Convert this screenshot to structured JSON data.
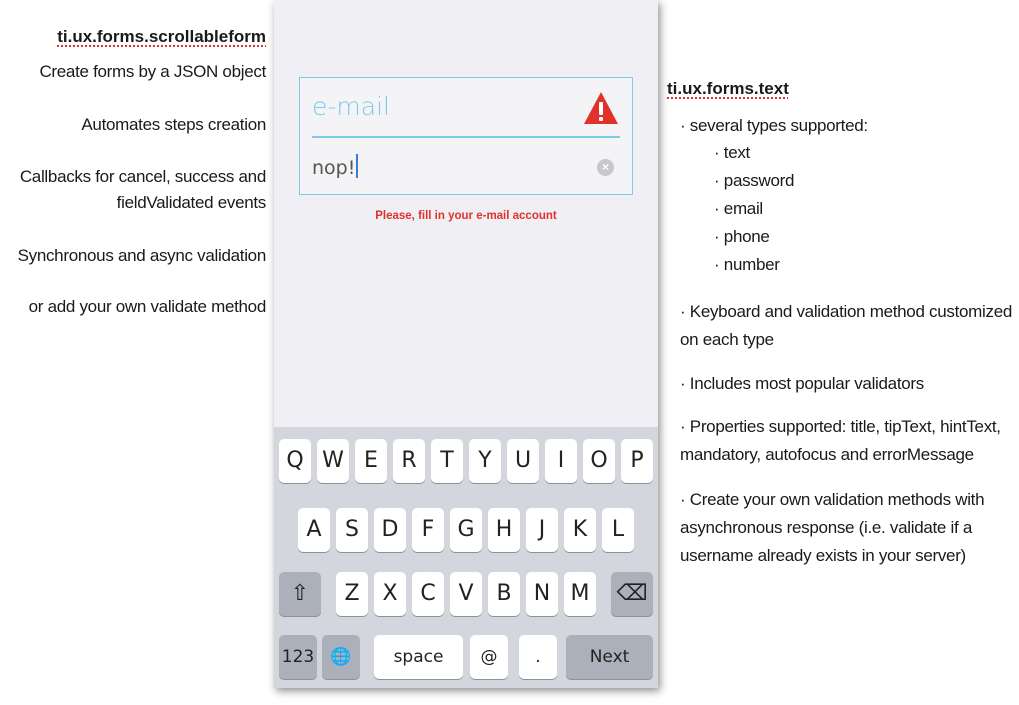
{
  "left": {
    "title": "ti.ux.forms.scrollableform",
    "items": [
      "Create forms by a JSON object",
      "Automates steps creation",
      "Callbacks for cancel, success and",
      "fieldValidated events",
      "Synchronous and async validation",
      "or add your own validate method"
    ]
  },
  "phone": {
    "field_title": "e-mail",
    "field_value": "nop!",
    "error_message": "Please, fill in your e-mail account",
    "keyboard": {
      "row1": [
        "Q",
        "W",
        "E",
        "R",
        "T",
        "Y",
        "U",
        "I",
        "O",
        "P"
      ],
      "row2": [
        "A",
        "S",
        "D",
        "F",
        "G",
        "H",
        "J",
        "K",
        "L"
      ],
      "row3": [
        "Z",
        "X",
        "C",
        "V",
        "B",
        "N",
        "M"
      ],
      "numbers_label": "123",
      "space_label": "space",
      "at_label": "@",
      "dot_label": ".",
      "next_label": "Next",
      "shift_glyph": "⇧",
      "backspace_glyph": "⌫",
      "globe_glyph": "🌐"
    }
  },
  "right": {
    "title": "ti.ux.forms.text",
    "lines": [
      "· several types supported:",
      "· text",
      "· password",
      "· email",
      "· phone",
      "· number",
      "· Keyboard and validation method customized",
      "on each type",
      "· Includes most popular validators",
      "· Properties supported: title, tipText, hintText,",
      "mandatory, autofocus and errorMessage",
      "· Create your own validation methods with",
      "asynchronous response (i.e. validate if a",
      "username already exists in your server)"
    ]
  },
  "colors": {
    "accent": "#7ecbe8",
    "error": "#e0322b",
    "keyboard_bg": "#d3d6dc"
  },
  "icons": [
    "warning-icon",
    "clear-icon",
    "shift-icon",
    "backspace-icon",
    "globe-icon"
  ]
}
